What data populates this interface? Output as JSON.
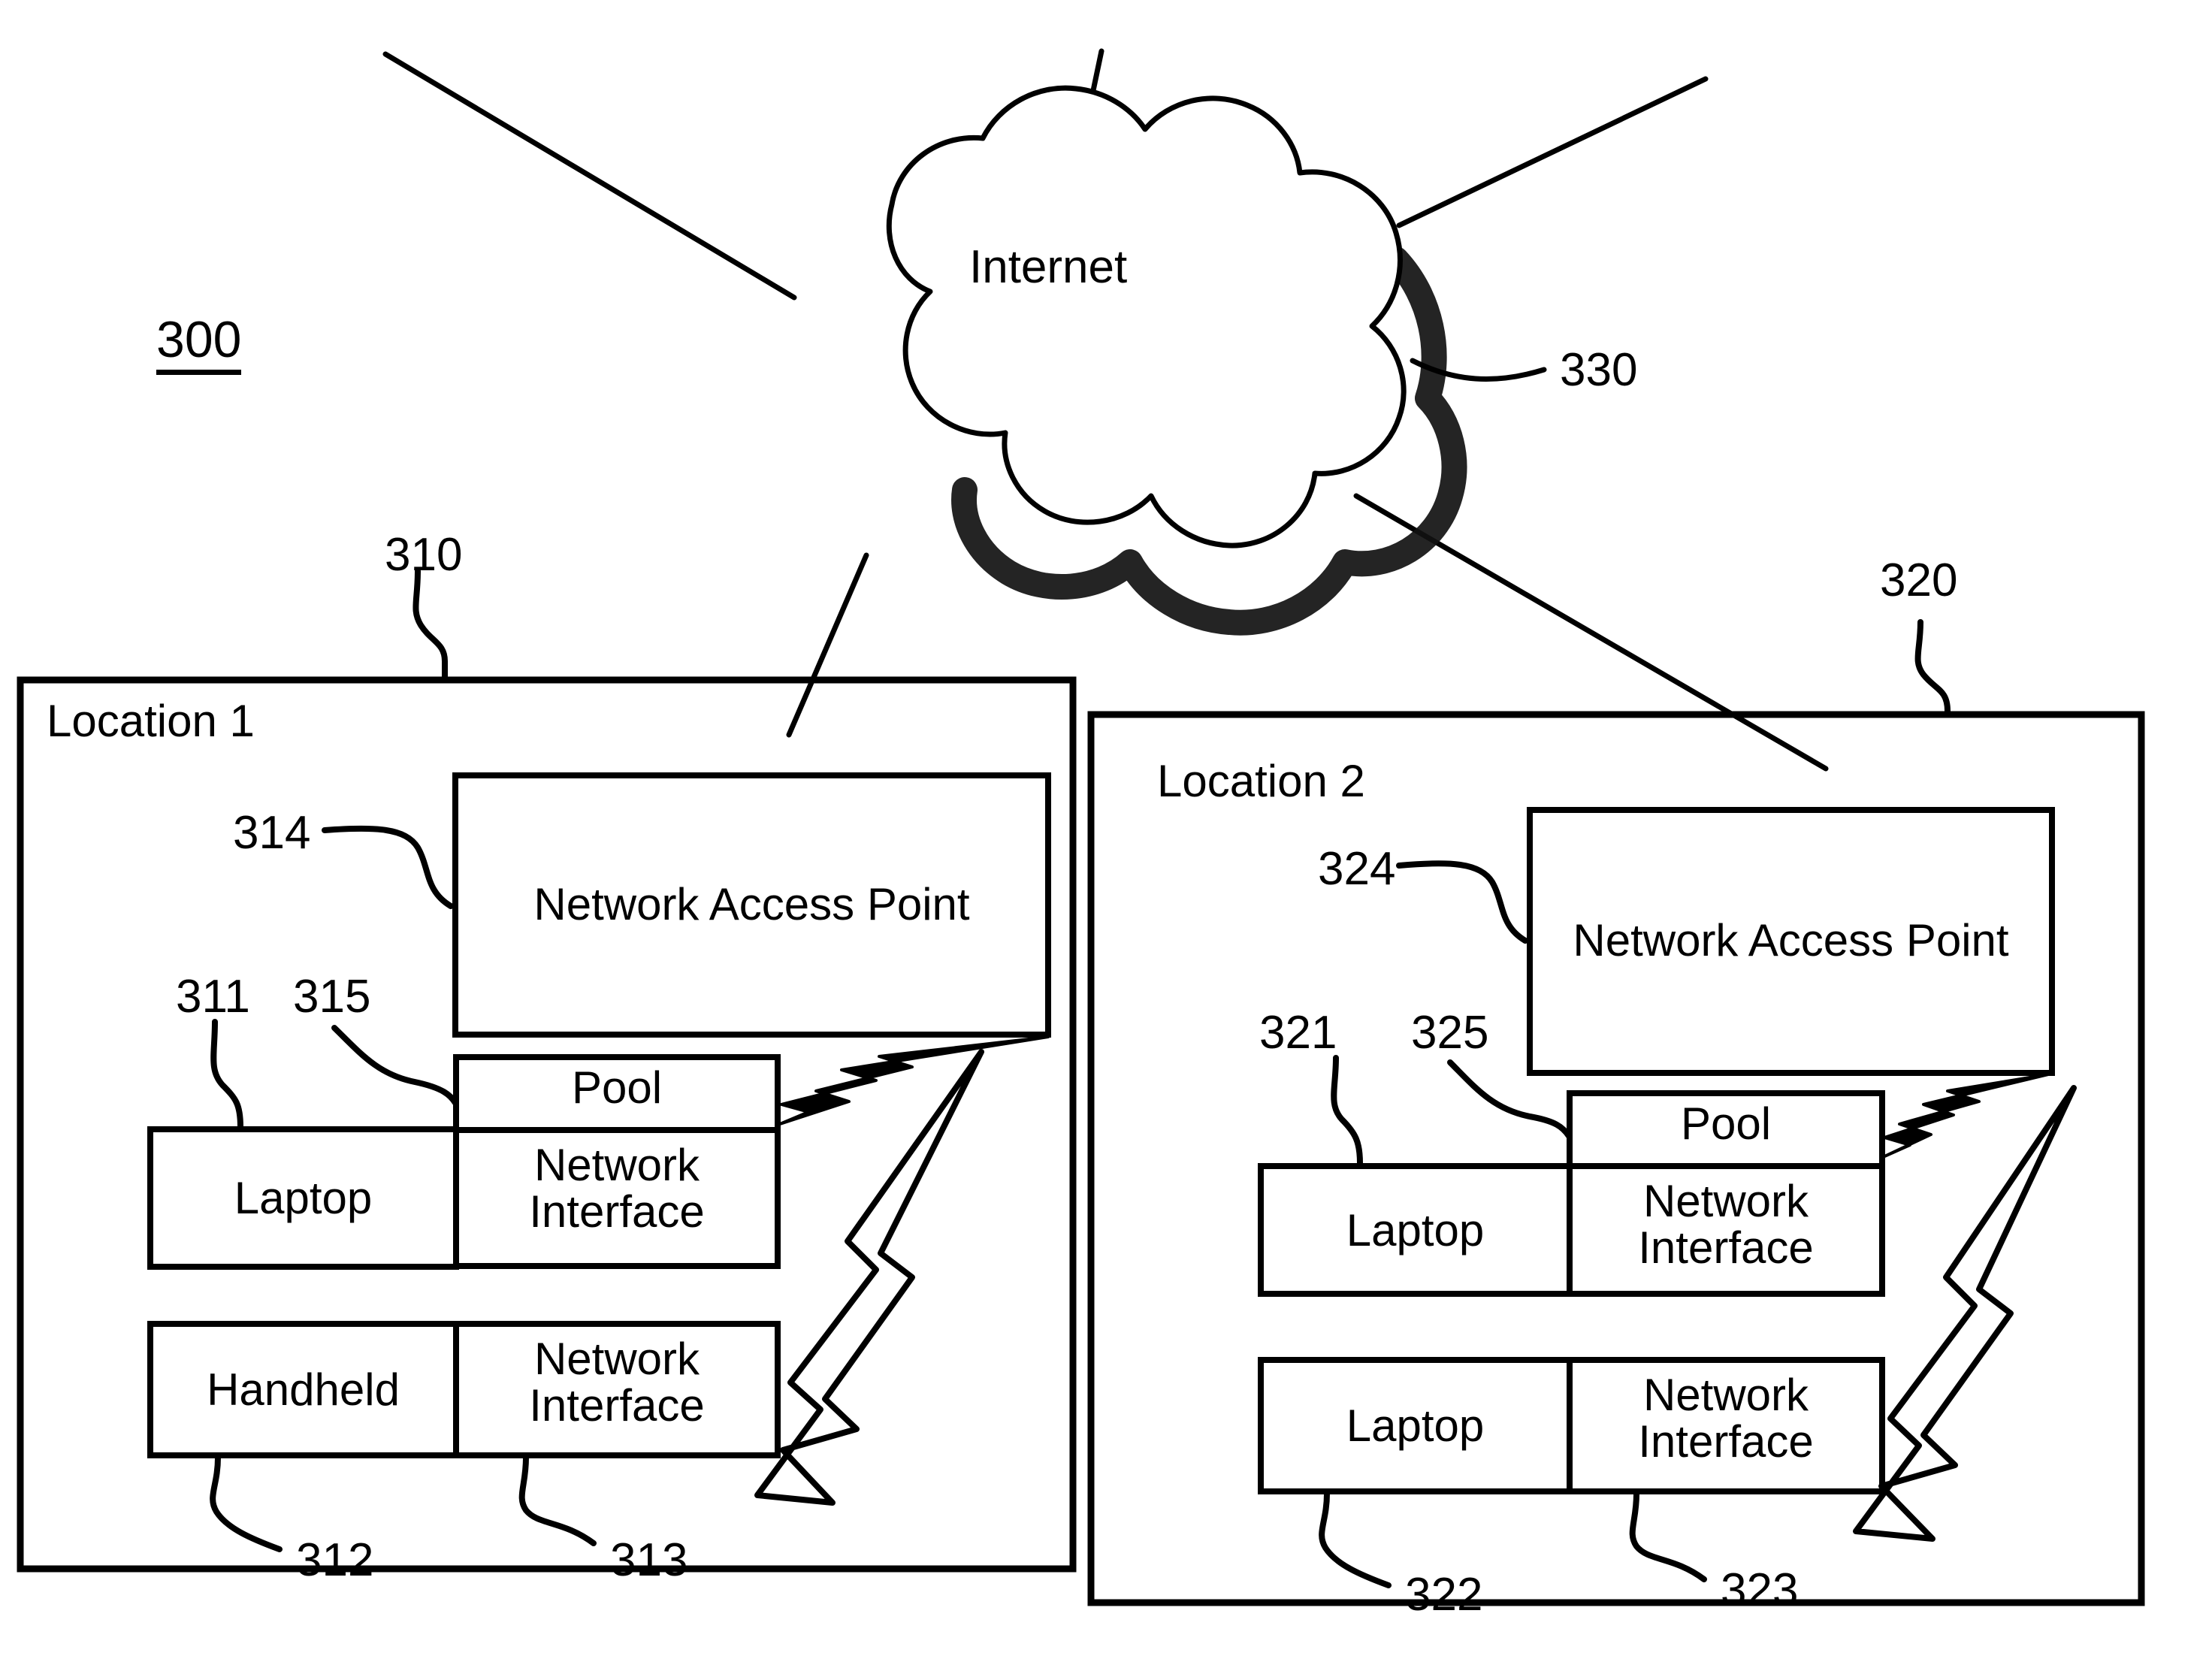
{
  "figure": {
    "number": "300",
    "cloud_label": "Internet",
    "cloud_ref": "330"
  },
  "locations": [
    {
      "ref": "310",
      "title": "Location 1",
      "access_point": {
        "ref": "314",
        "label": "Network Access Point"
      },
      "pool": {
        "ref": "315",
        "label": "Pool"
      },
      "devices": [
        {
          "ref": "311",
          "name": "Laptop",
          "interface_label_line1": "Network",
          "interface_label_line2": "Interface"
        },
        {
          "ref": "312",
          "name": "Handheld",
          "interface_ref": "313",
          "interface_label_line1": "Network",
          "interface_label_line2": "Interface"
        }
      ]
    },
    {
      "ref": "320",
      "title": "Location 2",
      "access_point": {
        "ref": "324",
        "label": "Network Access Point"
      },
      "pool": {
        "ref": "325",
        "label": "Pool"
      },
      "devices": [
        {
          "ref": "321",
          "name": "Laptop",
          "interface_label_line1": "Network",
          "interface_label_line2": "Interface"
        },
        {
          "ref": "322",
          "name": "Laptop",
          "interface_ref": "323",
          "interface_label_line1": "Network",
          "interface_label_line2": "Interface"
        }
      ]
    }
  ],
  "colors": {
    "ink": "#000000",
    "paper": "#ffffff"
  }
}
